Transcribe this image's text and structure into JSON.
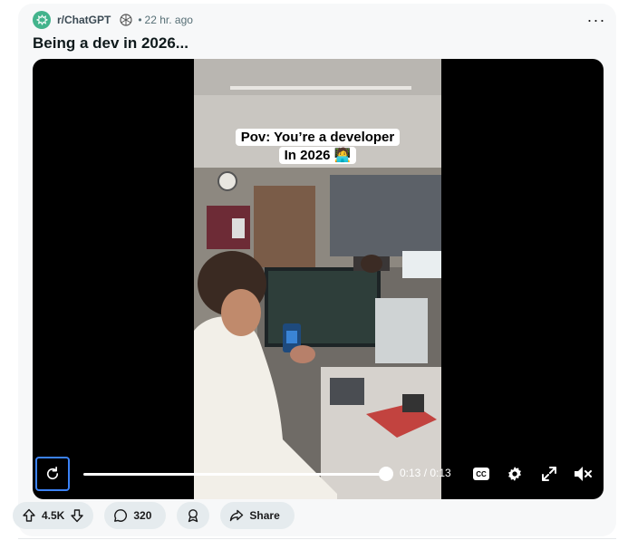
{
  "post": {
    "subreddit": "r/ChatGPT",
    "separator": "•",
    "age": "22 hr. ago",
    "more_label": "···",
    "title": "Being a dev in 2026..."
  },
  "video": {
    "caption_line1": "Pov: You’re a developer",
    "caption_line2": "In 2026 🧑‍💻",
    "timecode": "0:13 / 0:13",
    "progress": 1.0
  },
  "actions": {
    "votes": "4.5K",
    "comments": "320",
    "share": "Share"
  },
  "colors": {
    "subreddit_icon": "#43b38c",
    "focus_ring": "#3b82f6",
    "pill_bg": "#e5ebee"
  }
}
